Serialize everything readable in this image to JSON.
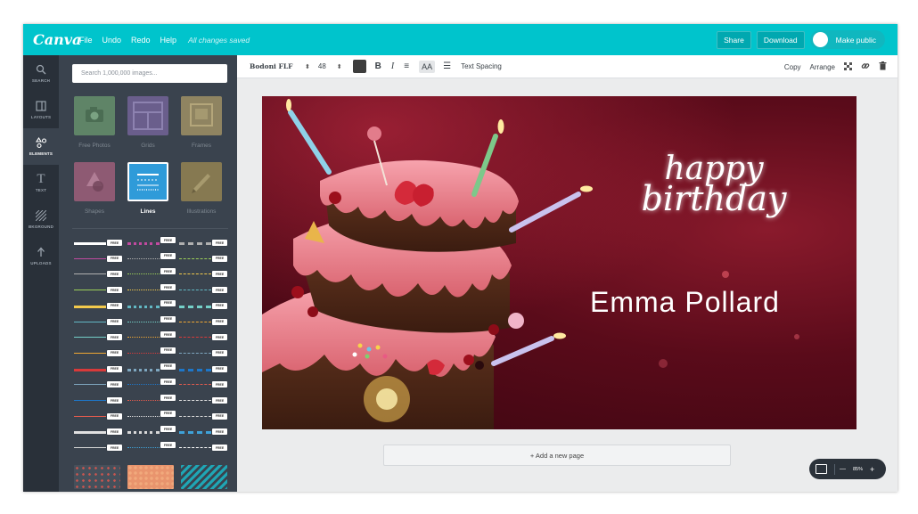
{
  "app": {
    "logo": "Canva",
    "menu": [
      "File",
      "Undo",
      "Redo",
      "Help"
    ],
    "status": "All changes saved",
    "share": "Share",
    "download": "Download",
    "make_public": "Make public"
  },
  "sidebar": {
    "items": [
      {
        "label": "SEARCH",
        "icon": "search-icon",
        "glyph": "⚲"
      },
      {
        "label": "LAYOUTS",
        "icon": "layouts-icon",
        "glyph": "◫"
      },
      {
        "label": "ELEMENTS",
        "icon": "elements-icon",
        "glyph": "⟡"
      },
      {
        "label": "TEXT",
        "icon": "text-icon",
        "glyph": "T"
      },
      {
        "label": "BKGROUND",
        "icon": "background-icon",
        "glyph": "▨"
      },
      {
        "label": "UPLOADS",
        "icon": "uploads-icon",
        "glyph": "↑"
      }
    ],
    "active": "ELEMENTS"
  },
  "panel": {
    "search_placeholder": "Search 1,000,000 images...",
    "categories": [
      {
        "label": "Free Photos",
        "color": "#5f8467",
        "icon": "camera-icon"
      },
      {
        "label": "Grids",
        "color": "#6a5e8c",
        "icon": "grid-icon"
      },
      {
        "label": "Frames",
        "color": "#8f8461",
        "icon": "frame-icon"
      },
      {
        "label": "Shapes",
        "color": "#8e5a73",
        "icon": "shapes-icon"
      },
      {
        "label": "Lines",
        "color": "#2f9bd9",
        "icon": "lines-icon"
      },
      {
        "label": "Illustrations",
        "color": "#867951",
        "icon": "illustration-icon"
      }
    ],
    "active_category": "Lines",
    "free_badge": "FREE"
  },
  "toolbar": {
    "font": "Bodoni FLF",
    "size": "48",
    "text_spacing": "Text Spacing",
    "copy": "Copy",
    "arrange": "Arrange"
  },
  "design": {
    "headline_line1": "happy",
    "headline_line2": "birthday",
    "name": "Emma Pollard"
  },
  "add_page": "+ Add a new page",
  "zoom": {
    "minus": "—",
    "level": "85%",
    "plus": "+"
  }
}
